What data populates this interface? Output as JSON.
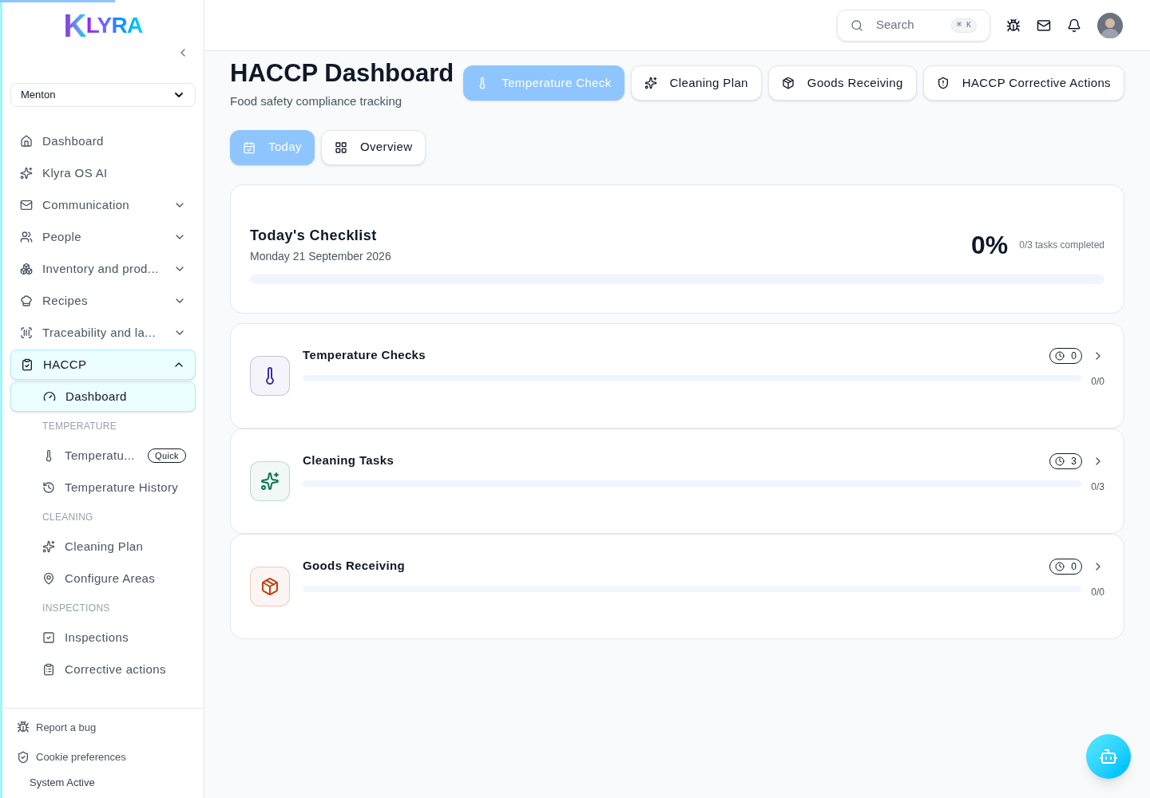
{
  "loading_bar": {
    "level": 0.1
  },
  "sidebar": {
    "logo": {
      "mark": "K",
      "text": "LYRA"
    },
    "location": {
      "value": "Menton"
    },
    "nav": [
      {
        "label": "Dashboard",
        "selected": false
      },
      {
        "label": "Klyra OS AI",
        "selected": false
      },
      {
        "label": "Communication",
        "expandable": true,
        "expanded": false,
        "selected": false
      },
      {
        "label": "People",
        "expandable": true,
        "expanded": false,
        "selected": false
      },
      {
        "label": "Inventory and prod...",
        "expandable": true,
        "expanded": false,
        "selected": false
      },
      {
        "label": "Recipes",
        "expandable": true,
        "expanded": false,
        "selected": false
      },
      {
        "label": "Traceability and la...",
        "expandable": true,
        "expanded": false,
        "selected": false
      },
      {
        "label": "HACCP",
        "expandable": true,
        "expanded": true,
        "selected": true,
        "children": [
          {
            "kind": "link",
            "label": "Dashboard",
            "selected": true
          },
          {
            "kind": "heading",
            "label": "TEMPERATURE"
          },
          {
            "kind": "link",
            "label": "Temperatu...",
            "selected": false,
            "badge": "Quick"
          },
          {
            "kind": "link",
            "label": "Temperature History",
            "selected": false
          },
          {
            "kind": "heading",
            "label": "CLEANING"
          },
          {
            "kind": "link",
            "label": "Cleaning Plan",
            "selected": false
          },
          {
            "kind": "link",
            "label": "Configure Areas",
            "selected": false
          },
          {
            "kind": "heading",
            "label": "INSPECTIONS"
          },
          {
            "kind": "link",
            "label": "Inspections",
            "selected": false
          },
          {
            "kind": "link",
            "label": "Corrective actions",
            "selected": false
          }
        ]
      }
    ],
    "footer": {
      "links": [
        "Report a bug",
        "Cookie preferences"
      ],
      "status": "System Active"
    }
  },
  "header": {
    "search": {
      "placeholder": "Search",
      "shortcut": "⌘ K"
    }
  },
  "page": {
    "title": "HACCP Dashboard",
    "subtitle": "Food safety compliance tracking",
    "actions": [
      {
        "label": "Temperature Check",
        "selected": true
      },
      {
        "label": "Cleaning Plan",
        "selected": false
      },
      {
        "label": "Goods Receiving",
        "selected": false
      },
      {
        "label": "HACCP Corrective Actions",
        "selected": false
      }
    ],
    "views": [
      {
        "label": "Today",
        "selected": true
      },
      {
        "label": "Overview",
        "selected": false
      }
    ],
    "checklist": {
      "title": "Today's Checklist",
      "date": "Monday 21 September 2026",
      "percent": "0%",
      "caption": "0/3 tasks completed",
      "level": 0
    },
    "categories": [
      {
        "name": "Temperature Checks",
        "color": "#3730a3",
        "pending": "0",
        "count": "0/0",
        "level": 0
      },
      {
        "name": "Cleaning Tasks",
        "color": "#047857",
        "pending": "3",
        "count": "0/3",
        "level": 0
      },
      {
        "name": "Goods Receiving",
        "color": "#c2410c",
        "pending": "0",
        "count": "0/0",
        "level": 0
      }
    ]
  }
}
